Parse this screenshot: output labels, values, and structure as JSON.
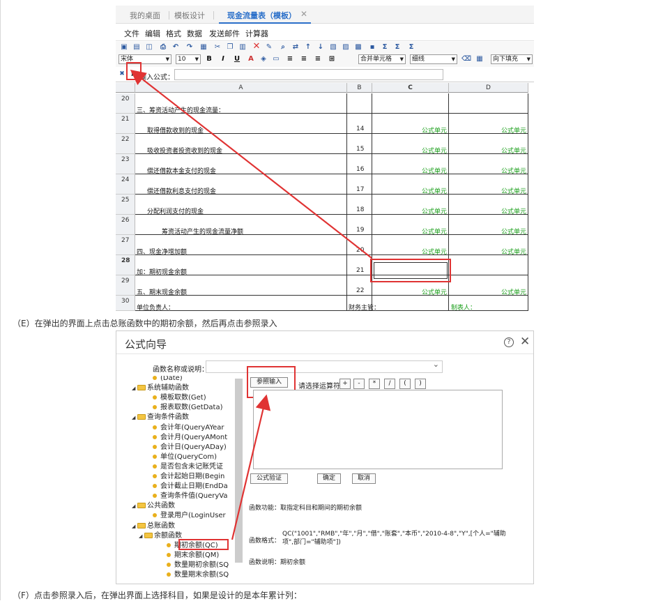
{
  "panel1": {
    "tabs": [
      "我的桌面",
      "模板设计",
      "现金流量表（模板）"
    ],
    "menu": [
      "文件",
      "编辑",
      "格式",
      "数据",
      "发送邮件",
      "计算器"
    ],
    "font_name": "宋体",
    "font_size": "10",
    "merge_label": "合并单元格",
    "line_label": "细线",
    "fill_label": "向下填充",
    "formula_label": "输入公式：",
    "fx_label": "fx",
    "col_headers": [
      "A",
      "B",
      "C",
      "D"
    ],
    "rows": [
      {
        "n": "20",
        "a": "三、筹资活动产生的现金流量：",
        "b": "",
        "c": "",
        "d": ""
      },
      {
        "n": "21",
        "a": "取得借款收到的现金",
        "b": "14",
        "c": "公式单元",
        "d": "公式单元"
      },
      {
        "n": "22",
        "a": "吸收投资者投资收到的现金",
        "b": "15",
        "c": "公式单元",
        "d": "公式单元"
      },
      {
        "n": "23",
        "a": "偿还借款本金支付的现金",
        "b": "16",
        "c": "公式单元",
        "d": "公式单元"
      },
      {
        "n": "24",
        "a": "偿还借款利息支付的现金",
        "b": "17",
        "c": "公式单元",
        "d": "公式单元"
      },
      {
        "n": "25",
        "a": "分配利润支付的现金",
        "b": "18",
        "c": "公式单元",
        "d": "公式单元"
      },
      {
        "n": "26",
        "a": "筹资活动产生的现金流量净额",
        "b": "19",
        "c": "公式单元",
        "d": "公式单元"
      },
      {
        "n": "27",
        "a": "四、现金净增加额",
        "b": "20",
        "c": "公式单元",
        "d": "公式单元"
      },
      {
        "n": "28",
        "a": "加：期初现金余额",
        "b": "21",
        "c": "",
        "d": ""
      },
      {
        "n": "29",
        "a": "五、期末现金余额",
        "b": "22",
        "c": "公式单元",
        "d": "公式单元"
      },
      {
        "n": "30",
        "a": "单位负责人：",
        "b": "财务主管：",
        "c": "",
        "d": "制表人："
      }
    ]
  },
  "caption1": "（E）在弹出的界面上点击总账函数中的期初余额，然后再点击参照录入",
  "panel2": {
    "title": "公式向导",
    "help": "?",
    "close": "✕",
    "fn_label": "函数名称或说明：",
    "tree": [
      {
        "label": "(Date)",
        "level": 2,
        "kind": "leaf"
      },
      {
        "label": "系统辅助函数",
        "level": 0,
        "kind": "folder"
      },
      {
        "label": "模板取数(Get)",
        "level": 2,
        "kind": "leaf"
      },
      {
        "label": "报表取数(GetData)",
        "level": 2,
        "kind": "leaf"
      },
      {
        "label": "查询条件函数",
        "level": 0,
        "kind": "folder"
      },
      {
        "label": "会计年(QueryAYear",
        "level": 2,
        "kind": "leaf"
      },
      {
        "label": "会计月(QueryAMont",
        "level": 2,
        "kind": "leaf"
      },
      {
        "label": "会计日(QueryADay)",
        "level": 2,
        "kind": "leaf"
      },
      {
        "label": "单位(QueryCom)",
        "level": 2,
        "kind": "leaf"
      },
      {
        "label": "是否包含未记账凭证",
        "level": 2,
        "kind": "leaf"
      },
      {
        "label": "会计起始日期(Begin",
        "level": 2,
        "kind": "leaf"
      },
      {
        "label": "会计截止日期(EndDa",
        "level": 2,
        "kind": "leaf"
      },
      {
        "label": "查询条件值(QueryVa",
        "level": 2,
        "kind": "leaf"
      },
      {
        "label": "公共函数",
        "level": 0,
        "kind": "folder"
      },
      {
        "label": "登录用户(LoginUser",
        "level": 2,
        "kind": "leaf"
      },
      {
        "label": "总账函数",
        "level": 0,
        "kind": "folder"
      },
      {
        "label": "余额函数",
        "level": 1,
        "kind": "folder"
      },
      {
        "label": "期初余额(QC)",
        "level": 3,
        "kind": "leaf"
      },
      {
        "label": "期末余额(QM)",
        "level": 3,
        "kind": "leaf"
      },
      {
        "label": "数量期初余额(SQ",
        "level": 3,
        "kind": "leaf"
      },
      {
        "label": "数量期末余额(SQ",
        "level": 3,
        "kind": "leaf"
      }
    ],
    "ref_button": "参照输入",
    "op_label": "请选择运算符：",
    "ops": [
      "+",
      "-",
      "*",
      "/",
      "(",
      ")"
    ],
    "validate_button": "公式验证",
    "ok_button": "确定",
    "cancel_button": "取消",
    "func_desc_label": "函数功能：",
    "func_desc": "取指定科目和期间的期初余额",
    "func_fmt_label": "函数格式：",
    "func_fmt_1": "QC(\"1001\",\"RMB\",\"年\",\"月\",\"借\",\"账套\",\"本币\",\"2010-4-8\",\"Y\",[个人=\"辅助",
    "func_fmt_2": "项\",部门=\"辅助项\"])",
    "func_note_label": "函数说明：",
    "func_note": "期初余额"
  },
  "caption2": "（F）点击参照录入后，在弹出界面上选择科目，如果是设计的是本年累计列：",
  "colors": {
    "accent": "#2a6fc9",
    "annotation": "#e03333",
    "formula_text": "#1a9e1a"
  }
}
